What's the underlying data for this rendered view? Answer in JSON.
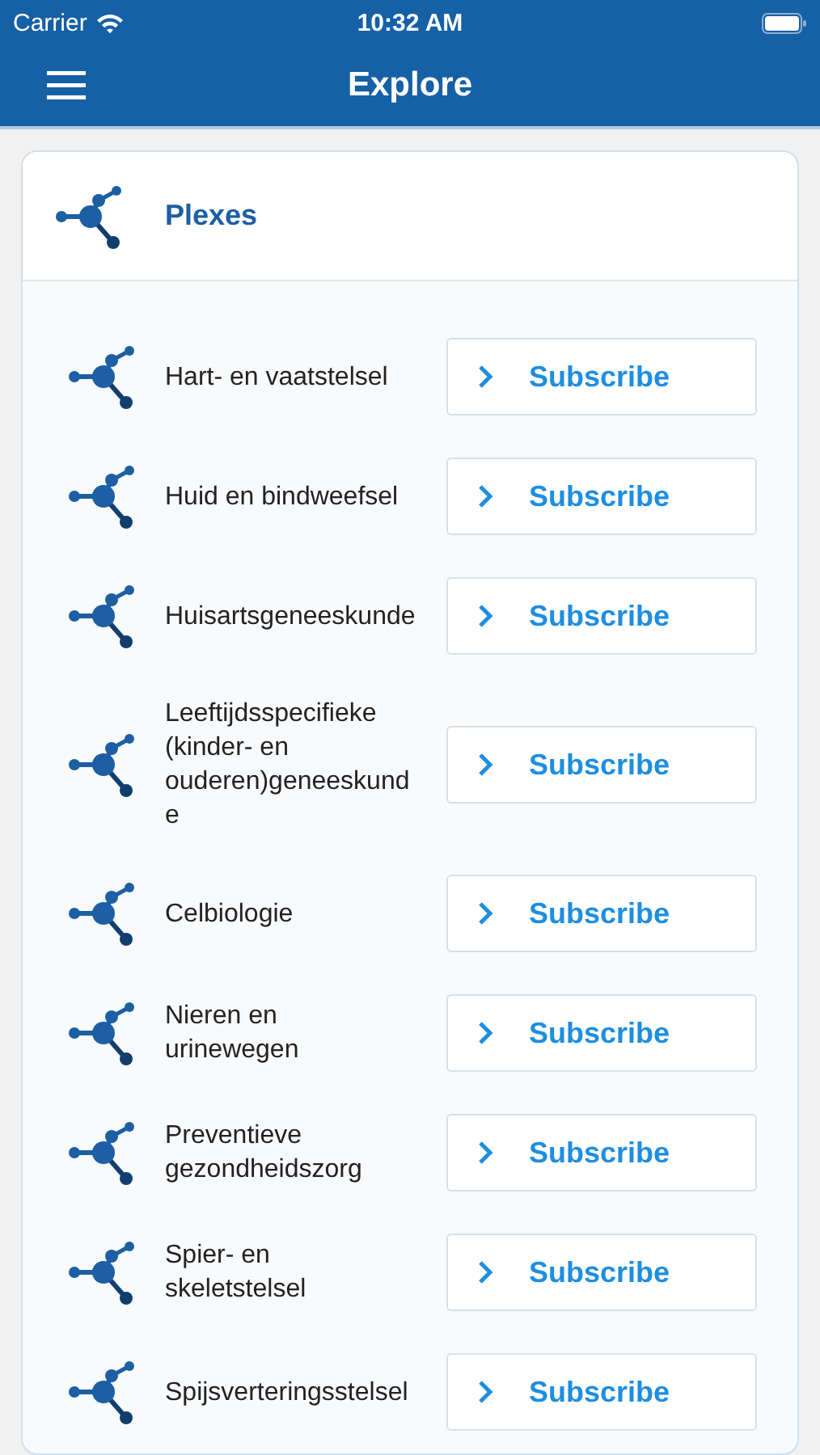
{
  "status_bar": {
    "carrier": "Carrier",
    "time": "10:32 AM"
  },
  "nav_bar": {
    "title": "Explore"
  },
  "section": {
    "title": "Plexes",
    "items": [
      {
        "name": "Hart- en vaatstelsel",
        "action": "Subscribe"
      },
      {
        "name": "Huid en bindweefsel",
        "action": "Subscribe"
      },
      {
        "name": "Huisartsgeneeskunde",
        "action": "Subscribe"
      },
      {
        "name": "Leeftijdsspecifieke (kinder- en ouderen)geneeskunde",
        "action": "Subscribe"
      },
      {
        "name": "Celbiologie",
        "action": "Subscribe"
      },
      {
        "name": "Nieren en urinewegen",
        "action": "Subscribe"
      },
      {
        "name": "Preventieve gezondheidszorg",
        "action": "Subscribe"
      },
      {
        "name": "Spier- en skeletstelsel",
        "action": "Subscribe"
      },
      {
        "name": "Spijsverteringsstelsel",
        "action": "Subscribe"
      }
    ]
  }
}
